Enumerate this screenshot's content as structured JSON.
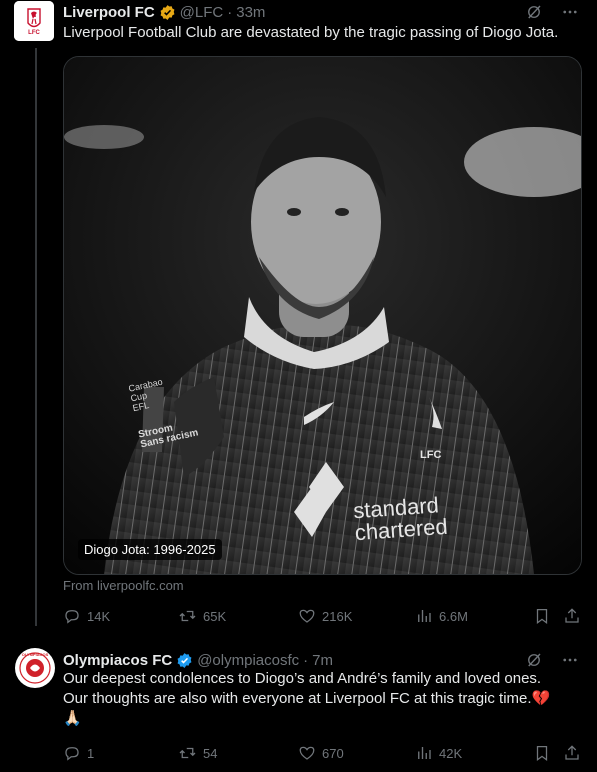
{
  "tweets": [
    {
      "author": {
        "name": "Liverpool FC",
        "handle": "@LFC",
        "avatar_text": "LFC",
        "verified_color": "#E8A915"
      },
      "time": "33m",
      "text": "Liverpool Football Club are devastated by the tragic passing of Diogo Jota.",
      "media": {
        "caption": "Diogo Jota: 1996-2025",
        "jersey_text_1": "standard",
        "jersey_text_2": "chartered",
        "badge_text": "LFC",
        "sleeve_text_1": "Carabao",
        "sleeve_text_2": "Cup",
        "sleeve_text_3": "EFL",
        "sleeve_text_4": "Stroom",
        "sleeve_text_5": "Sans racism"
      },
      "source": "From liverpoolfc.com",
      "stats": {
        "replies": "14K",
        "reposts": "65K",
        "likes": "216K",
        "views": "6.6M"
      }
    },
    {
      "author": {
        "name": "Olympiacos FC",
        "handle": "@olympiacosfc",
        "avatar_text": "OLYMPIACOS",
        "verified_color": "#1D9BF0"
      },
      "time": "7m",
      "text_line1": "Our deepest condolences to Diogo’s and André’s family and loved ones.",
      "text_line2": "Our thoughts are also with everyone at Liverpool FC at this tragic time.",
      "emoji_1": "💔",
      "emoji_2": "🙏🏻",
      "stats": {
        "replies": "1",
        "reposts": "54",
        "likes": "670",
        "views": "42K"
      }
    }
  ],
  "icons": [
    "grok-icon",
    "more-icon",
    "reply-icon",
    "repost-icon",
    "like-icon",
    "views-icon",
    "bookmark-icon",
    "share-icon"
  ],
  "colors": {
    "background": "#000000",
    "text": "#E7E9EA",
    "secondary": "#71767B",
    "lfc_red": "#C8102E",
    "verified_blue": "#1D9BF0",
    "verified_gold": "#E8A915"
  }
}
